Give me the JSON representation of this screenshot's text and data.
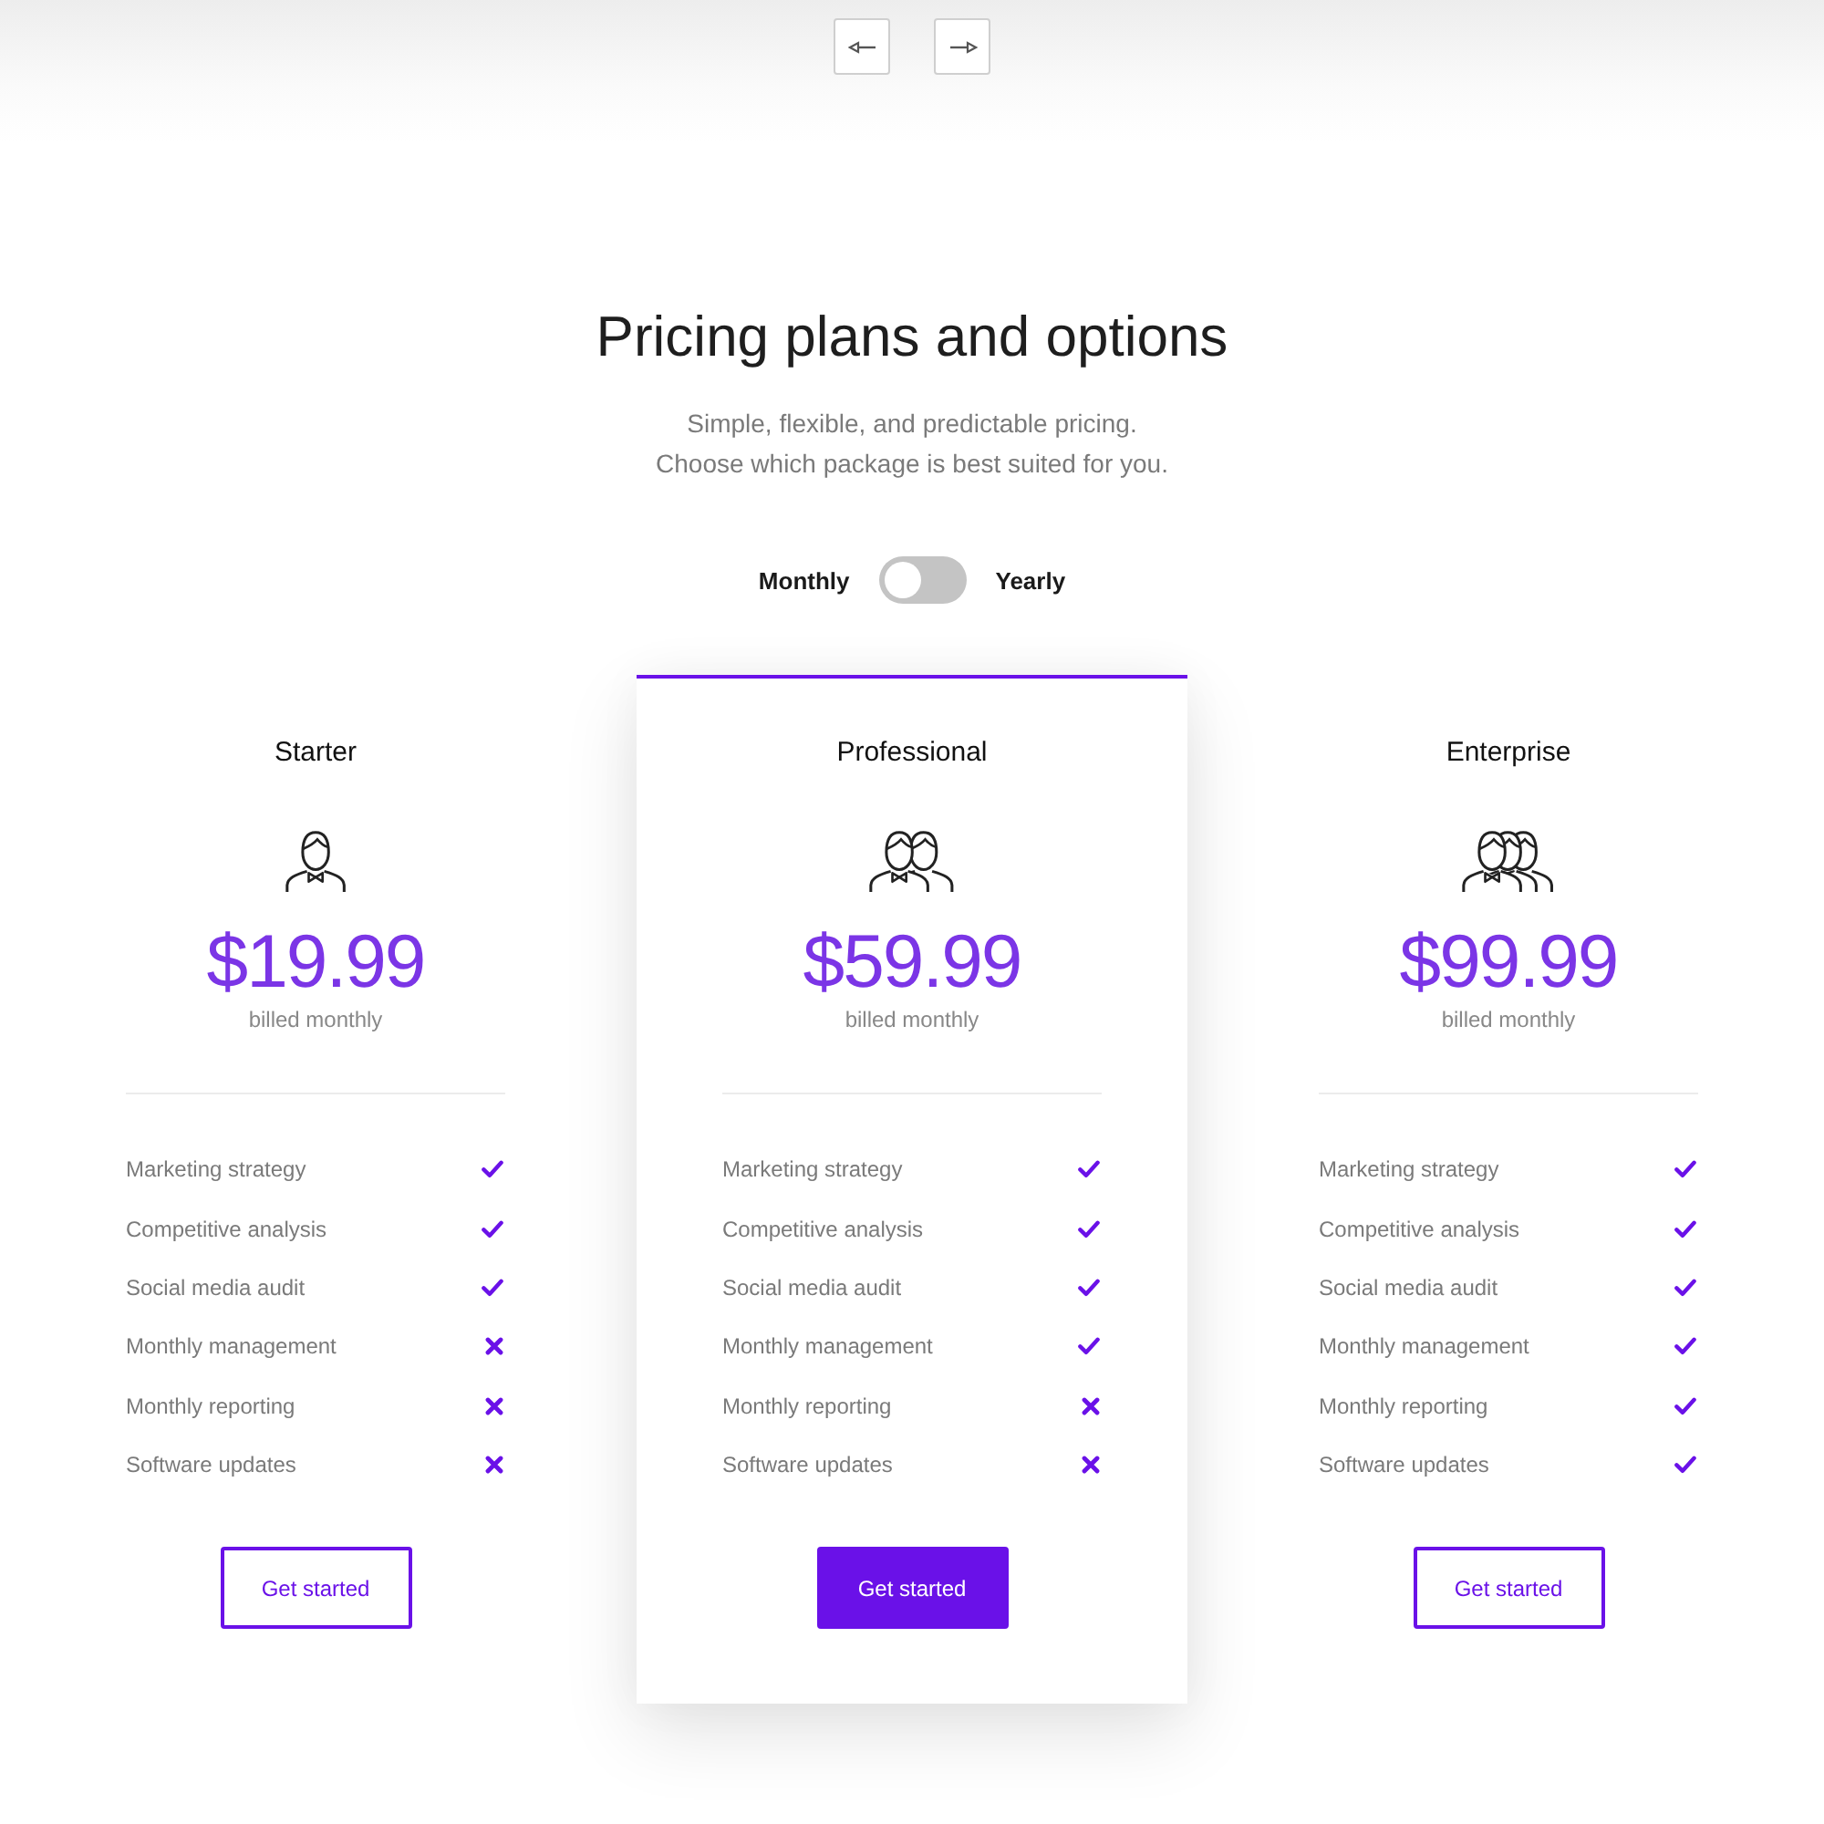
{
  "heading": {
    "title": "Pricing plans and options",
    "subtitle_lines": [
      "Simple, flexible, and predictable pricing.",
      "Choose which package is best suited for you."
    ]
  },
  "billing_toggle": {
    "left_label": "Monthly",
    "right_label": "Yearly",
    "on": false
  },
  "plans": [
    {
      "name": "Starter",
      "price": "$19.99",
      "period": "billed monthly",
      "featured": false,
      "features": [
        {
          "label": "Marketing strategy",
          "included": true
        },
        {
          "label": "Competitive analysis",
          "included": true
        },
        {
          "label": "Social media audit",
          "included": true
        },
        {
          "label": "Monthly management",
          "included": false
        },
        {
          "label": "Monthly reporting",
          "included": false
        },
        {
          "label": "Software updates",
          "included": false
        }
      ],
      "button": "Get started"
    },
    {
      "name": "Professional",
      "price": "$59.99",
      "period": "billed monthly",
      "featured": true,
      "features": [
        {
          "label": "Marketing strategy",
          "included": true
        },
        {
          "label": "Competitive analysis",
          "included": true
        },
        {
          "label": "Social media audit",
          "included": true
        },
        {
          "label": "Monthly management",
          "included": true
        },
        {
          "label": "Monthly reporting",
          "included": false
        },
        {
          "label": "Software updates",
          "included": false
        }
      ],
      "button": "Get started"
    },
    {
      "name": "Enterprise",
      "price": "$99.99",
      "period": "billed monthly",
      "featured": false,
      "features": [
        {
          "label": "Marketing strategy",
          "included": true
        },
        {
          "label": "Competitive analysis",
          "included": true
        },
        {
          "label": "Social media audit",
          "included": true
        },
        {
          "label": "Monthly management",
          "included": true
        },
        {
          "label": "Monthly reporting",
          "included": true
        },
        {
          "label": "Software updates",
          "included": true
        }
      ],
      "button": "Get started"
    }
  ]
}
